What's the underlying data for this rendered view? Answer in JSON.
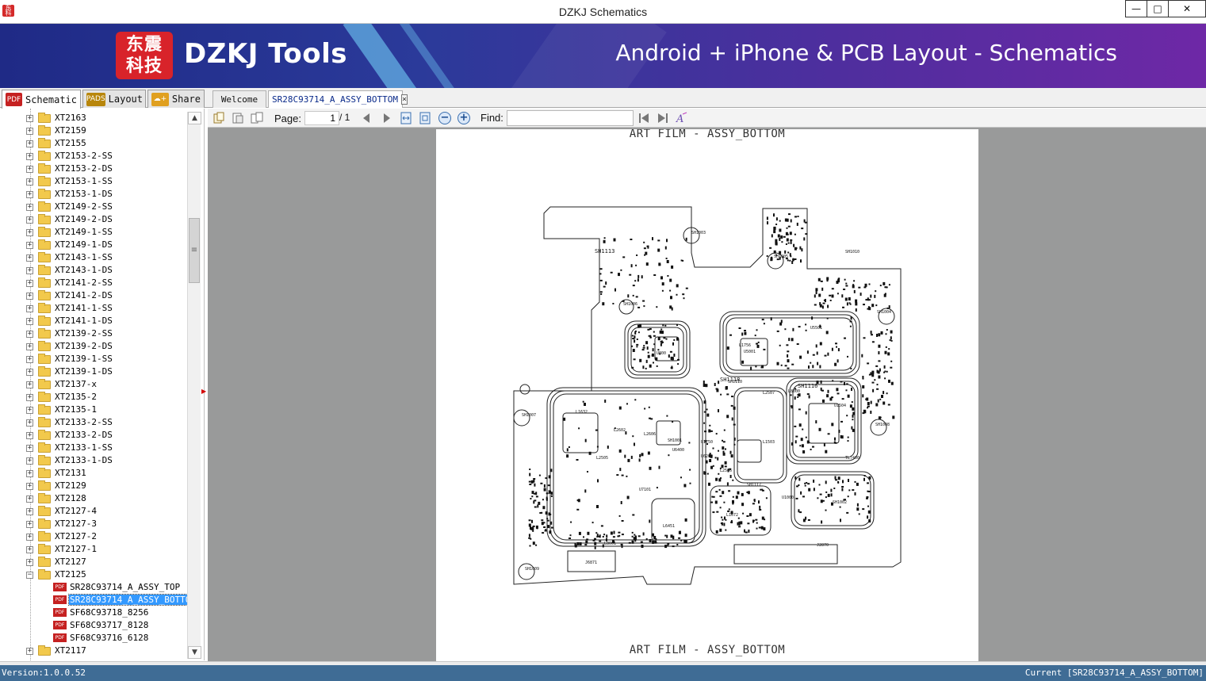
{
  "window": {
    "title": "DZKJ Schematics",
    "minimize": "—",
    "maximize": "□",
    "close": "✕"
  },
  "banner": {
    "logo_text": "东震科技",
    "brand": "DZKJ Tools",
    "tagline": "Android + iPhone & PCB Layout - Schematics"
  },
  "left_tabs": [
    {
      "label": "Schematic",
      "icon": "PDF",
      "color": "#c52121"
    },
    {
      "label": "Layout",
      "icon": "PADS",
      "color": "#b8860b"
    },
    {
      "label": "Share",
      "icon": "☁+",
      "color": "#e0a020"
    }
  ],
  "doc_tabs": [
    {
      "label": "Welcome"
    },
    {
      "label": "SR28C93714_A_ASSY_BOTTOM",
      "close": "×"
    }
  ],
  "tree": {
    "folders_before": [
      "XT2163",
      "XT2159",
      "XT2155",
      "XT2153-2-SS",
      "XT2153-2-DS",
      "XT2153-1-SS",
      "XT2153-1-DS",
      "XT2149-2-SS",
      "XT2149-2-DS",
      "XT2149-1-SS",
      "XT2149-1-DS",
      "XT2143-1-SS",
      "XT2143-1-DS",
      "XT2141-2-SS",
      "XT2141-2-DS",
      "XT2141-1-SS",
      "XT2141-1-DS",
      "XT2139-2-SS",
      "XT2139-2-DS",
      "XT2139-1-SS",
      "XT2139-1-DS",
      "XT2137-x",
      "XT2135-2",
      "XT2135-1",
      "XT2133-2-SS",
      "XT2133-2-DS",
      "XT2133-1-SS",
      "XT2133-1-DS",
      "XT2131",
      "XT2129",
      "XT2128",
      "XT2127-4",
      "XT2127-3",
      "XT2127-2",
      "XT2127-1",
      "XT2127"
    ],
    "expanded_folder": "XT2125",
    "files": [
      "SR28C93714_A_ASSY_TOP",
      "SR28C93714_A_ASSY_BOTTOM",
      "SF68C93718_8256",
      "SF68C93717_8128",
      "SF68C93716_6128"
    ],
    "selected_file": "SR28C93714_A_ASSY_BOTTOM",
    "folders_after": [
      "XT2117"
    ],
    "pdf_badge": "PDF",
    "collapsed_glyph": "+",
    "expanded_glyph": "−"
  },
  "toolbar": {
    "page_label": "Page:",
    "page_value": "1",
    "page_total": "/ 1",
    "find_label": "Find:",
    "find_value": ""
  },
  "document": {
    "title_top": "ART FILM - ASSY_BOTTOM",
    "title_bottom": "ART FILM - ASSY_BOTTOM",
    "labels": [
      "SH1113",
      "SH1118",
      "SH1116",
      "SH1117",
      "SH1110",
      "U800",
      "U5001",
      "U5501",
      "U6400",
      "L1632",
      "L2602",
      "L2606",
      "L1672",
      "L6451",
      "J2870",
      "J6871",
      "SH1004",
      "SH1008",
      "SH1003",
      "SH1005",
      "SH1006",
      "SH1007",
      "SH1009",
      "SH1010",
      "SH1002",
      "SH1001",
      "U1750",
      "U6200",
      "L2505",
      "L2506",
      "L2507",
      "L1503",
      "U1504",
      "L1756",
      "L8000",
      "L8001",
      "U7101",
      "U1000",
      "TL7400"
    ]
  },
  "status": {
    "version": "Version:1.0.0.52",
    "current": "Current [SR28C93714_A_ASSY_BOTTOM]"
  }
}
